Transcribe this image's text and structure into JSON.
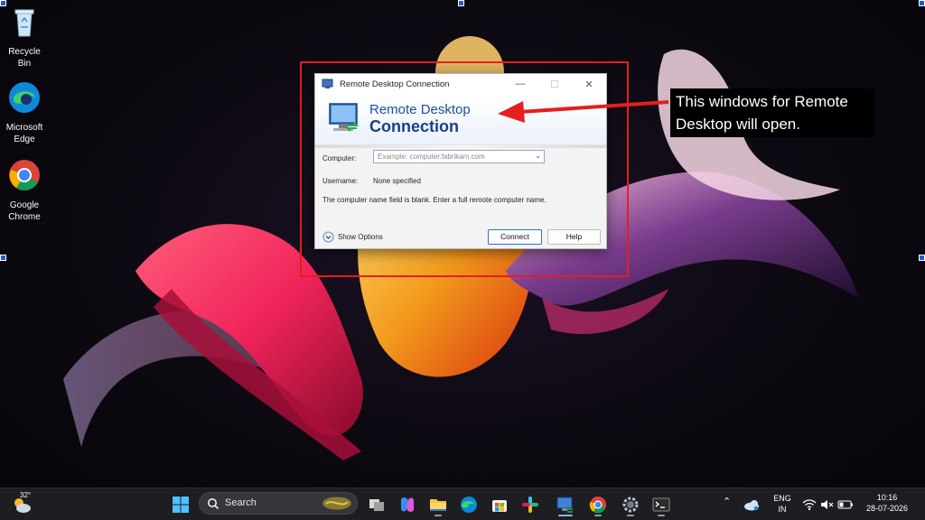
{
  "desktop": {
    "icons": [
      {
        "label": "Recycle Bin",
        "icon": "recycle-bin-icon"
      },
      {
        "label": "Microsoft Edge",
        "icon": "edge-icon"
      },
      {
        "label": "Google Chrome",
        "icon": "chrome-icon"
      }
    ]
  },
  "dialog": {
    "title": "Remote Desktop Connection",
    "banner_line1": "Remote Desktop",
    "banner_line2": "Connection",
    "computer_label": "Computer:",
    "computer_placeholder": "Example: computer.fabrikam.com",
    "computer_value": "",
    "username_label": "Username:",
    "username_value": "None specified",
    "message": "The computer name field is blank. Enter a full remote computer name.",
    "show_options": "Show Options",
    "connect_label": "Connect",
    "help_label": "Help"
  },
  "annotation": {
    "callout_text": "This windows for Remote Desktop will open.",
    "color": "#e51e1e"
  },
  "taskbar": {
    "weather": "32°",
    "search_label": "Search",
    "apps": [
      "start-icon",
      "search-icon",
      "task-view-icon",
      "copilot-icon",
      "file-explorer-icon",
      "edge-icon",
      "store-icon",
      "slack-icon",
      "remote-desktop-icon",
      "chrome-icon",
      "settings-icon",
      "terminal-icon"
    ],
    "lang_line1": "ENG",
    "lang_line2": "IN",
    "time": "10:16",
    "date": "28-07-2026"
  }
}
